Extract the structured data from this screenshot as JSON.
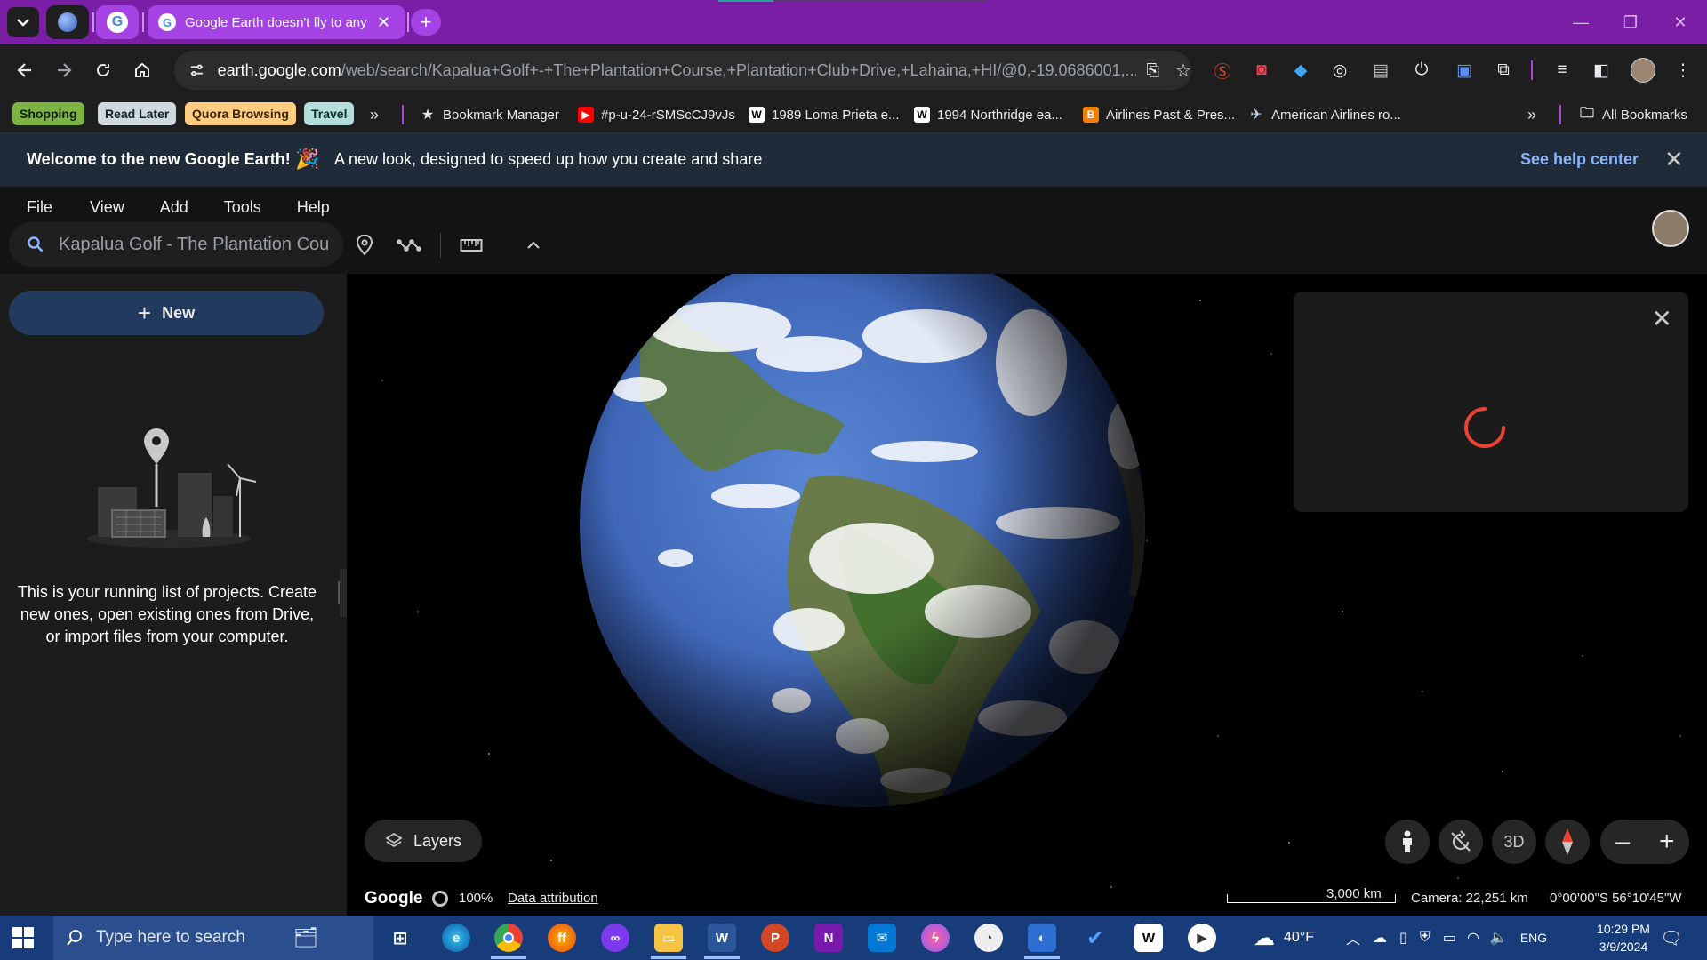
{
  "browser": {
    "active_tab_title": "Google Earth doesn't fly to any",
    "url_host": "earth.google.com",
    "url_path": "/web/search/Kapalua+Golf+-+The+Plantation+Course,+Plantation+Club+Drive,+Lahaina,+HI/@0,-19.0686001,..."
  },
  "bookmarks": {
    "chips": [
      {
        "label": "Shopping",
        "bg": "#7cb342",
        "fg": "#10200a"
      },
      {
        "label": "Read Later",
        "bg": "#cfd8dc",
        "fg": "#10222a"
      },
      {
        "label": "Quora Browsing",
        "bg": "#ffcc80",
        "fg": "#3a2500"
      },
      {
        "label": "Travel",
        "bg": "#b2dfdb",
        "fg": "#0d2b28"
      }
    ],
    "items": [
      {
        "label": "Bookmark Manager",
        "icon": "star-icon"
      },
      {
        "label": "#p-u-24-rSMScCJ9vJs",
        "icon": "youtube-icon"
      },
      {
        "label": "1989 Loma Prieta e...",
        "icon": "wikipedia-icon"
      },
      {
        "label": "1994 Northridge ea...",
        "icon": "wikipedia-icon"
      },
      {
        "label": "Airlines Past & Pres...",
        "icon": "blogger-icon"
      },
      {
        "label": "American Airlines ro...",
        "icon": "airline-icon"
      }
    ],
    "all_bookmarks": "All Bookmarks"
  },
  "banner": {
    "title": "Welcome to the new Google Earth!",
    "emoji": "🎉",
    "subtitle": "A new look, designed to speed up how you create and share",
    "help_link": "See help center"
  },
  "menu": [
    "File",
    "View",
    "Add",
    "Tools",
    "Help"
  ],
  "search": {
    "value": "Kapalua Golf - The Plantation Cou"
  },
  "projects": {
    "new_label": "New",
    "empty_text": "This is your running list of projects. Create new ones, open existing ones from Drive, or import files from your computer."
  },
  "map": {
    "layers_label": "Layers",
    "mode_3d": "3D",
    "google_logo": "Google",
    "load_pct": "100%",
    "attribution": "Data attribution",
    "scale": "3,000 km",
    "camera": "Camera: 22,251 km",
    "coords": "0°00'00\"S 56°10'45\"W"
  },
  "taskbar": {
    "search_placeholder": "Type here to search",
    "weather": "40°F",
    "lang": "ENG",
    "time": "10:29 PM",
    "date": "3/9/2024"
  },
  "colors": {
    "accent": "#a542e4",
    "banner_bg": "#202b3a",
    "help_link": "#8ab4f8",
    "new_btn": "#223a5e",
    "spinner": "#ea4335"
  }
}
